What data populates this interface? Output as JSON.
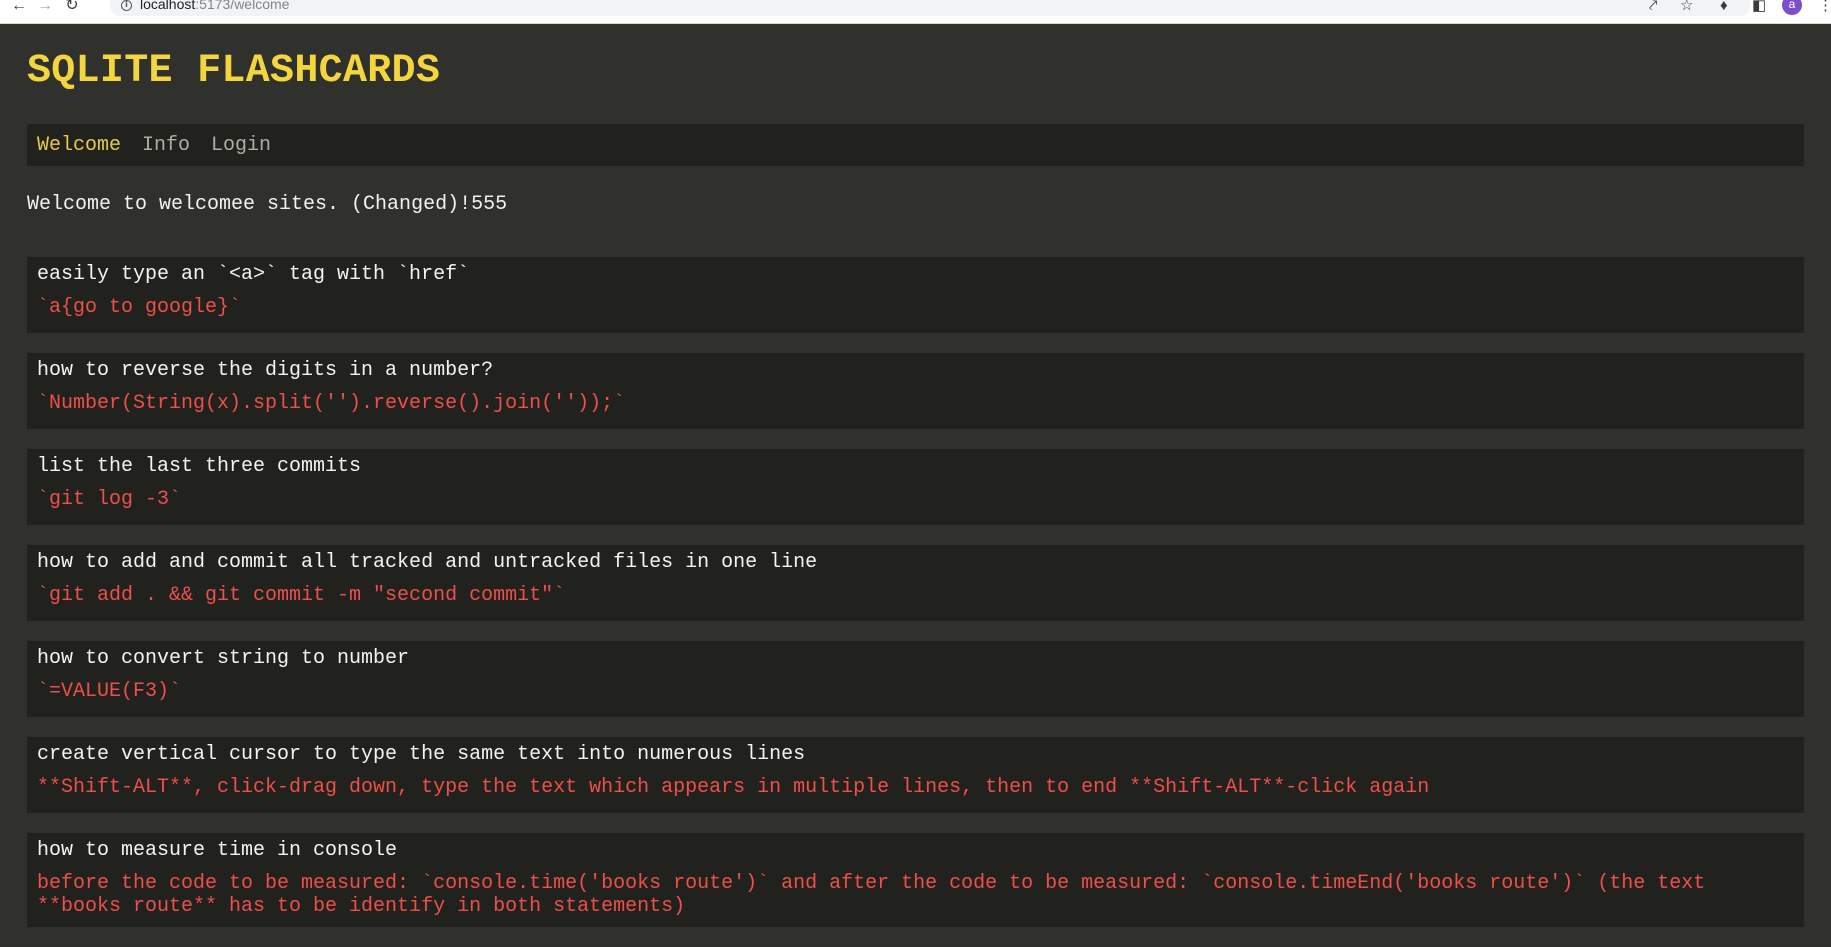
{
  "browser": {
    "url_host": "localhost",
    "url_path": ":5173/welcome",
    "avatar_initial": "a",
    "icons": {
      "back": "arrow-left-icon",
      "forward": "arrow-right-icon",
      "reload": "reload-icon",
      "info": "info-icon",
      "share": "share-icon",
      "bookmark": "star-icon",
      "extensions": "puzzle-icon",
      "sidepanel": "side-panel-icon",
      "menu": "kebab-menu-icon"
    }
  },
  "colors": {
    "background": "#30312c",
    "panel": "#21221e",
    "title": "#f3d53e",
    "nav_active": "#e5c94a",
    "nav_inactive": "#aeaea6",
    "question": "#f4f4f0",
    "answer": "#ee4f4a"
  },
  "site": {
    "title": "SQLITE FLASHCARDS"
  },
  "nav": {
    "items": [
      {
        "label": "Welcome",
        "active": true
      },
      {
        "label": "Info",
        "active": false
      },
      {
        "label": "Login",
        "active": false
      }
    ]
  },
  "welcome_text": "Welcome to welcomee sites. (Changed)!555",
  "flashcards": [
    {
      "question": "easily type an `<a>` tag with `href`",
      "answer": "`a{go to google}`"
    },
    {
      "question": "how to reverse the digits in a number?",
      "answer": "`Number(String(x).split('').reverse().join(''));`"
    },
    {
      "question": "list the last three commits",
      "answer": "`git log -3`"
    },
    {
      "question": "how to add and commit all tracked and untracked files in one line",
      "answer": "`git add . && git commit -m \"second commit\"`"
    },
    {
      "question": "how to convert string to number",
      "answer": "`=VALUE(F3)`"
    },
    {
      "question": "create vertical cursor to type the same text into numerous lines",
      "answer": "**Shift-ALT**, click-drag down, type the text which appears in multiple lines, then to end **Shift-ALT**-click again"
    },
    {
      "question": "how to measure time in console",
      "answer": "before the code to be measured: `console.time('books route')` and after the code to be measured: `console.timeEnd('books route')` (the text **books route** has to be identify in both statements)"
    }
  ]
}
